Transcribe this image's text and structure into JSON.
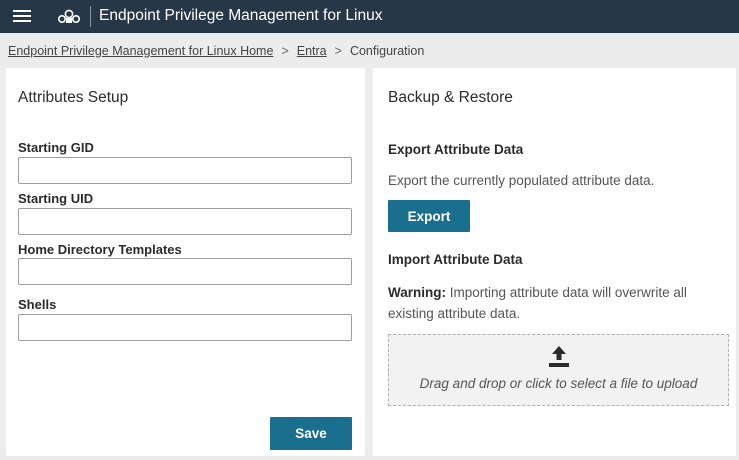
{
  "header": {
    "app_title": "Endpoint Privilege Management for Linux",
    "menu_icon": "hamburger-menu-icon",
    "logo_icon": "beyondtrust-logo-icon",
    "background_color": "#263747"
  },
  "breadcrumb": {
    "items": [
      "Endpoint Privilege Management for Linux Home",
      "Entra"
    ],
    "separator": ">",
    "current": "Configuration"
  },
  "attributes_setup": {
    "title": "Attributes Setup",
    "fields": [
      {
        "label": "Starting GID",
        "value": ""
      },
      {
        "label": "Starting UID",
        "value": ""
      },
      {
        "label": "Home Directory Templates",
        "value": ""
      },
      {
        "label": "Shells",
        "value": ""
      }
    ],
    "save_label": "Save"
  },
  "backup_restore": {
    "title": "Backup & Restore",
    "export_heading": "Export Attribute Data",
    "export_description": "Export the currently populated attribute data.",
    "export_label": "Export",
    "import_heading": "Import Attribute Data",
    "warning_label": "Warning:",
    "warning_text": "Importing attribute data will overwrite all existing attribute data.",
    "dropzone_text": "Drag and drop or click to select a file to upload",
    "upload_icon": "upload-icon"
  },
  "colors": {
    "accent": "#1a6e8e",
    "page_background": "#ececec"
  }
}
